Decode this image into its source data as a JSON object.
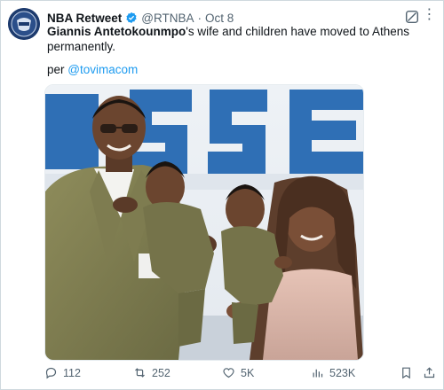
{
  "tweet": {
    "author": {
      "display_name": "NBA Retweet",
      "handle": "@RTNBA",
      "verified_icon": "verified-badge-icon"
    },
    "separator": "·",
    "date": "Oct 8",
    "text_mention": "Giannis Antetokounmpo",
    "text_rest": "'s wife and children have moved to Athens permanently.",
    "per_prefix": "per ",
    "per_link": "@tovimacom",
    "media_icon": "family-photo-image"
  },
  "actions": {
    "replies": "112",
    "retweets": "252",
    "likes": "5K",
    "views": "523K"
  },
  "icons": {
    "reply": "reply-icon",
    "retweet": "retweet-icon",
    "like": "heart-icon",
    "views": "views-icon",
    "bookmark": "bookmark-icon",
    "share": "share-icon",
    "grok": "grok-icon",
    "more": "more-icon"
  },
  "colors": {
    "link": "#1d9bf0",
    "secondary_text": "#536471",
    "primary_text": "#0f1419"
  }
}
